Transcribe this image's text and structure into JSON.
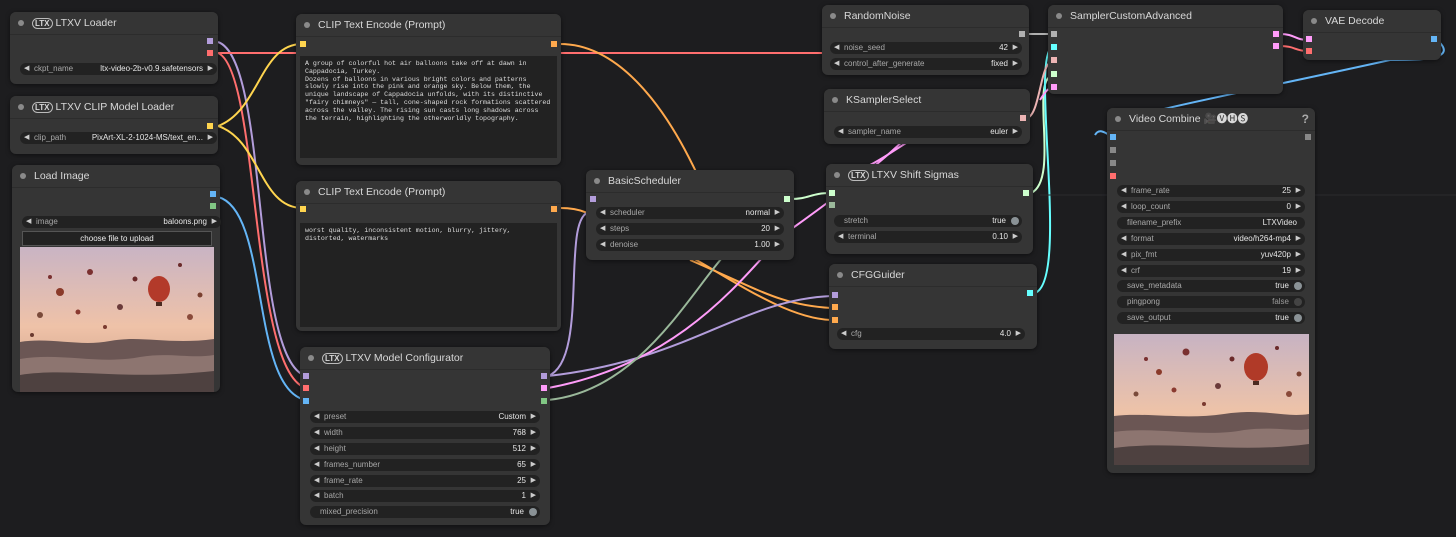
{
  "nodes": {
    "ltxv_loader": {
      "title": "LTXV Loader",
      "widgets": {
        "ckpt_name": {
          "label": "ckpt_name",
          "value": "ltx-video-2b-v0.9.safetensors"
        }
      }
    },
    "ltxv_clip_loader": {
      "title": "LTXV CLIP Model Loader",
      "widgets": {
        "clip_path": {
          "label": "clip_path",
          "value": "PixArt-XL-2-1024-MS/text_en..."
        }
      }
    },
    "load_image": {
      "title": "Load Image",
      "widgets": {
        "image": {
          "label": "image",
          "value": "baloons.png"
        },
        "upload_label": "choose file to upload"
      }
    },
    "clip_pos": {
      "title": "CLIP Text Encode (Prompt)",
      "text": "A group of colorful hot air balloons take off at dawn in Cappadocia, Turkey.\nDozens of balloons in various bright colors and patterns slowly rise into the pink and orange sky. Below them, the unique landscape of Cappadocia unfolds, with its distinctive \"fairy chimneys\" — tall, cone-shaped rock formations scattered across the valley. The rising sun casts long shadows across the terrain, highlighting the otherworldly topography."
    },
    "clip_neg": {
      "title": "CLIP Text Encode (Prompt)",
      "text": "worst quality, inconsistent motion, blurry, jittery, distorted, watermarks"
    },
    "basic_scheduler": {
      "title": "BasicScheduler",
      "widgets": {
        "scheduler": {
          "label": "scheduler",
          "value": "normal"
        },
        "steps": {
          "label": "steps",
          "value": "20"
        },
        "denoise": {
          "label": "denoise",
          "value": "1.00"
        }
      }
    },
    "random_noise": {
      "title": "RandomNoise",
      "widgets": {
        "noise_seed": {
          "label": "noise_seed",
          "value": "42"
        },
        "control_after_generate": {
          "label": "control_after_generate",
          "value": "fixed"
        }
      }
    },
    "ksampler_select": {
      "title": "KSamplerSelect",
      "widgets": {
        "sampler_name": {
          "label": "sampler_name",
          "value": "euler"
        }
      }
    },
    "shift_sigmas": {
      "title": "LTXV Shift Sigmas",
      "widgets": {
        "stretch": {
          "label": "stretch",
          "value": "true"
        },
        "terminal": {
          "label": "terminal",
          "value": "0.10"
        }
      }
    },
    "cfg_guider": {
      "title": "CFGGuider",
      "widgets": {
        "cfg": {
          "label": "cfg",
          "value": "4.0"
        }
      }
    },
    "sampler_custom_adv": {
      "title": "SamplerCustomAdvanced"
    },
    "vae_decode": {
      "title": "VAE Decode"
    },
    "model_configurator": {
      "title": "LTXV Model Configurator",
      "widgets": {
        "preset": {
          "label": "preset",
          "value": "Custom"
        },
        "width": {
          "label": "width",
          "value": "768"
        },
        "height": {
          "label": "height",
          "value": "512"
        },
        "frames_number": {
          "label": "frames_number",
          "value": "65"
        },
        "frame_rate": {
          "label": "frame_rate",
          "value": "25"
        },
        "batch": {
          "label": "batch",
          "value": "1"
        },
        "mixed_precision": {
          "label": "mixed_precision",
          "value": "true"
        }
      }
    },
    "video_combine": {
      "title": "Video Combine 🎥🅥🅗🅢",
      "help": "?",
      "widgets": {
        "frame_rate": {
          "label": "frame_rate",
          "value": "25"
        },
        "loop_count": {
          "label": "loop_count",
          "value": "0"
        },
        "filename_prefix": {
          "label": "filename_prefix",
          "value": "LTXVideo"
        },
        "format": {
          "label": "format",
          "value": "video/h264-mp4"
        },
        "pix_fmt": {
          "label": "pix_fmt",
          "value": "yuv420p"
        },
        "crf": {
          "label": "crf",
          "value": "19"
        },
        "save_metadata": {
          "label": "save_metadata",
          "value": "true"
        },
        "pingpong": {
          "label": "pingpong",
          "value": "false"
        },
        "save_output": {
          "label": "save_output",
          "value": "true"
        }
      }
    }
  },
  "brand": "LTX",
  "colors": {
    "background": "#1d1d1f",
    "node": "#353535",
    "widget": "#222222",
    "model": "#b39ddb",
    "clip": "#ffd54f",
    "conditioning": "#ffa94d",
    "latent": "#ff9cf9",
    "image": "#64b5f6",
    "vae": "#ff6e6e",
    "noise": "#b0b0b0",
    "sampler": "#ecb4b4",
    "sigmas": "#cdffcd",
    "guider": "#66ffff",
    "float": "#aaaaaa"
  },
  "icons": [
    "status-dot-icon",
    "ltx-brand-icon",
    "arrow-left-icon",
    "arrow-right-icon",
    "toggle-knob-icon",
    "help-icon"
  ]
}
